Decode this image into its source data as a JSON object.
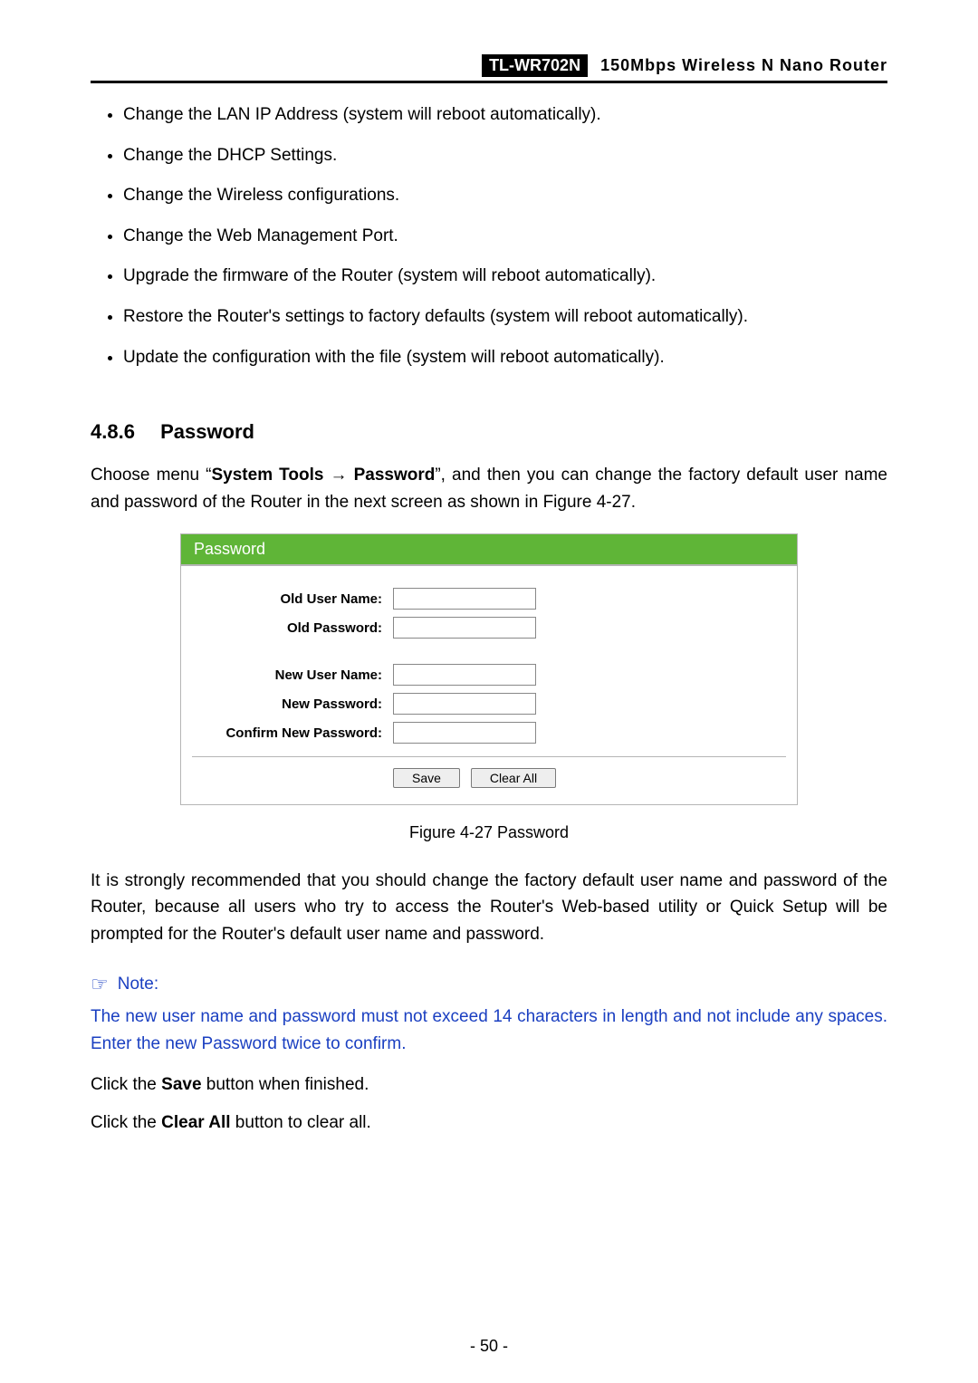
{
  "header": {
    "model": "TL-WR702N",
    "title": "150Mbps  Wireless  N  Nano  Router"
  },
  "bullets": [
    "Change the LAN IP Address (system will reboot automatically).",
    "Change the DHCP Settings.",
    "Change the Wireless configurations.",
    "Change the Web Management Port.",
    "Upgrade the firmware of the Router (system will reboot automatically).",
    "Restore the Router's settings to factory defaults (system will reboot automatically).",
    "Update the configuration with the file (system will reboot automatically)."
  ],
  "section": {
    "number": "4.8.6",
    "title": "Password"
  },
  "intro": {
    "prefix": "Choose menu “",
    "menu1": "System Tools",
    "arrow": " → ",
    "menu2": "Password",
    "suffix": "”, and then you can change the factory default user name and password of the Router in the next screen as shown in Figure 4-27."
  },
  "panel": {
    "title": "Password",
    "labels": {
      "old_user": "Old User Name:",
      "old_pass": "Old Password:",
      "new_user": "New User Name:",
      "new_pass": "New Password:",
      "confirm": "Confirm New Password:"
    },
    "buttons": {
      "save": "Save",
      "clear": "Clear All"
    }
  },
  "caption": "Figure 4-27    Password",
  "para_recommend": "It is strongly recommended that you should change the factory default user name and password of the Router, because all users who try to access the Router's Web-based utility or Quick Setup will be prompted for the Router's default user name and password.",
  "note": {
    "heading": "Note:",
    "body": "The new user name and password must not exceed 14 characters in length and not include any spaces. Enter the new Password twice to confirm."
  },
  "save_line": {
    "p1": "Click the ",
    "b": "Save",
    "p2": " button when finished."
  },
  "clear_line": {
    "p1": "Click the ",
    "b": "Clear All",
    "p2": " button to clear all."
  },
  "footer": "- 50 -"
}
